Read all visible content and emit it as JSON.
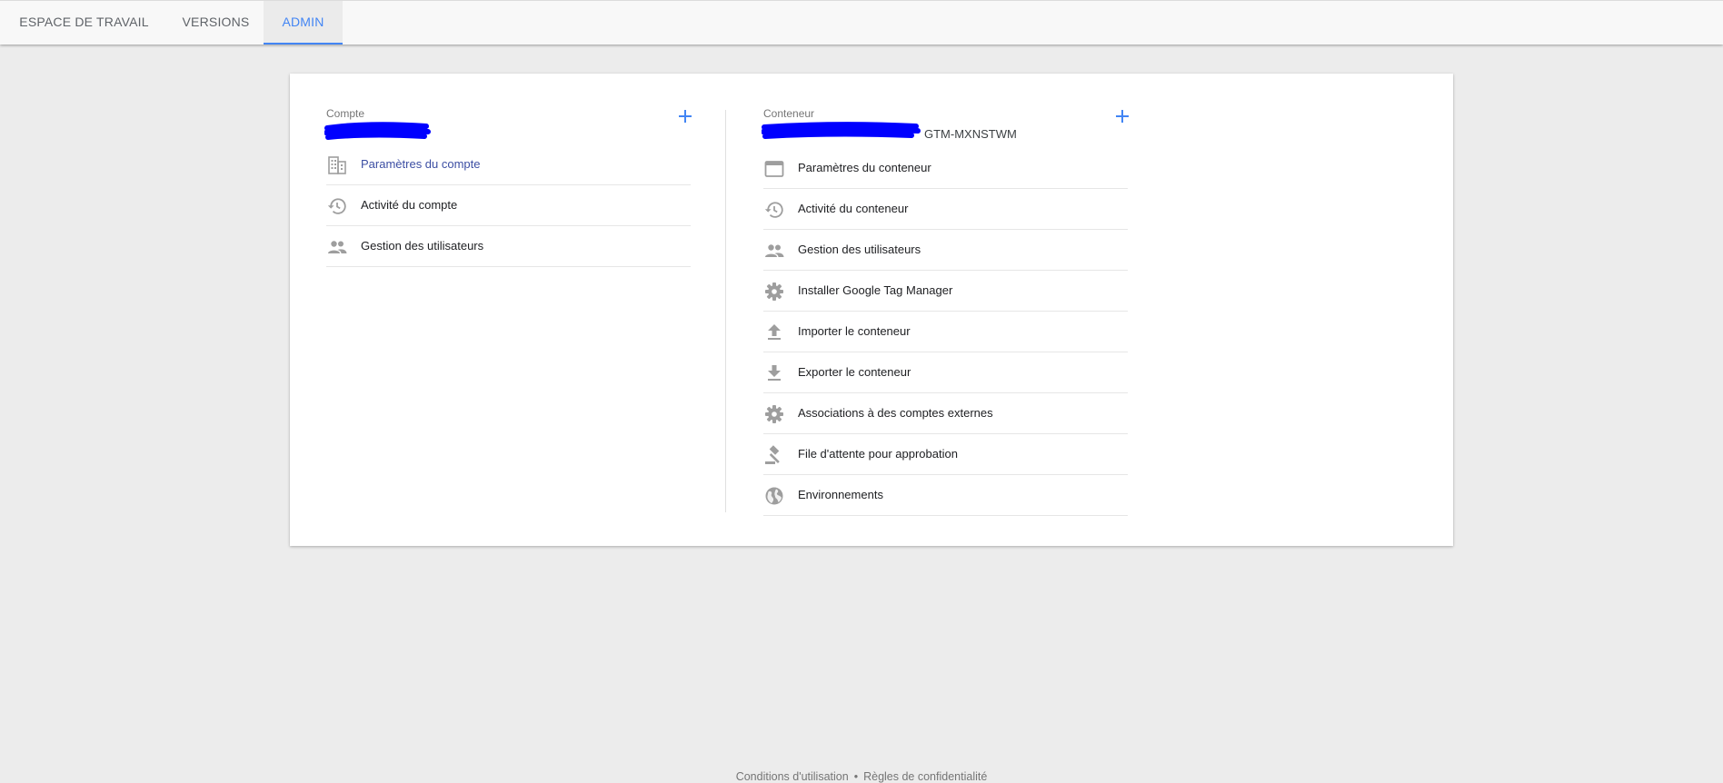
{
  "tabs": [
    {
      "label": "ESPACE DE TRAVAIL",
      "active": false
    },
    {
      "label": "VERSIONS",
      "active": false
    },
    {
      "label": "ADMIN",
      "active": true
    }
  ],
  "account": {
    "label": "Compte",
    "items": [
      {
        "label": "Paramètres du compte",
        "icon": "building-icon"
      },
      {
        "label": "Activité du compte",
        "icon": "history-icon"
      },
      {
        "label": "Gestion des utilisateurs",
        "icon": "people-icon"
      }
    ]
  },
  "container": {
    "label": "Conteneur",
    "id": "GTM-MXNSTWM",
    "items": [
      {
        "label": "Paramètres du conteneur",
        "icon": "window-icon"
      },
      {
        "label": "Activité du conteneur",
        "icon": "history-icon"
      },
      {
        "label": "Gestion des utilisateurs",
        "icon": "people-icon"
      },
      {
        "label": "Installer Google Tag Manager",
        "icon": "gear-icon"
      },
      {
        "label": "Importer le conteneur",
        "icon": "upload-icon"
      },
      {
        "label": "Exporter le conteneur",
        "icon": "download-icon"
      },
      {
        "label": "Associations à des comptes externes",
        "icon": "gear-icon"
      },
      {
        "label": "File d'attente pour approbation",
        "icon": "gavel-icon"
      },
      {
        "label": "Environnements",
        "icon": "globe-icon"
      }
    ]
  },
  "footer": {
    "terms": "Conditions d'utilisation",
    "separator": "•",
    "privacy": "Règles de confidentialité"
  },
  "colors": {
    "accent": "#4285f4",
    "link": "#3c4ea3",
    "redaction": "#0000ff",
    "icon": "#9e9e9e",
    "background": "#ececec"
  }
}
